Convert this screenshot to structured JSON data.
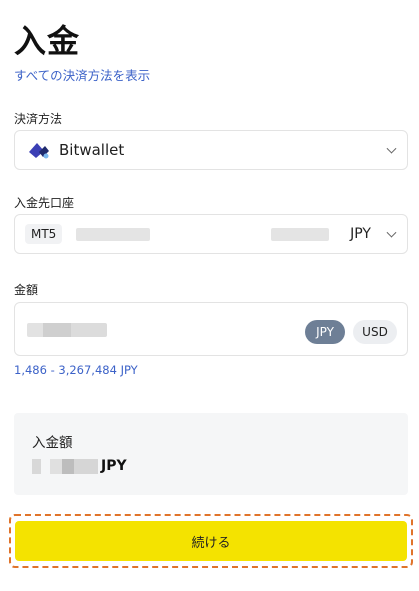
{
  "page": {
    "title": "入金",
    "all_methods_link": "すべての決済方法を表示"
  },
  "payment_method": {
    "label": "決済方法",
    "selected": "Bitwallet"
  },
  "account": {
    "label": "入金先口座",
    "platform": "MT5",
    "currency": "JPY"
  },
  "amount": {
    "label": "金額",
    "currencies": [
      "JPY",
      "USD"
    ],
    "selected_currency": "JPY",
    "range": "1,486 - 3,267,484 JPY"
  },
  "summary": {
    "label": "入金額",
    "currency": "JPY"
  },
  "actions": {
    "continue_label": "続ける"
  },
  "colors": {
    "link": "#3c62c8",
    "primary_button": "#f4e300",
    "highlight_outline": "#e0742b",
    "selected_chip": "#6e7f96"
  }
}
